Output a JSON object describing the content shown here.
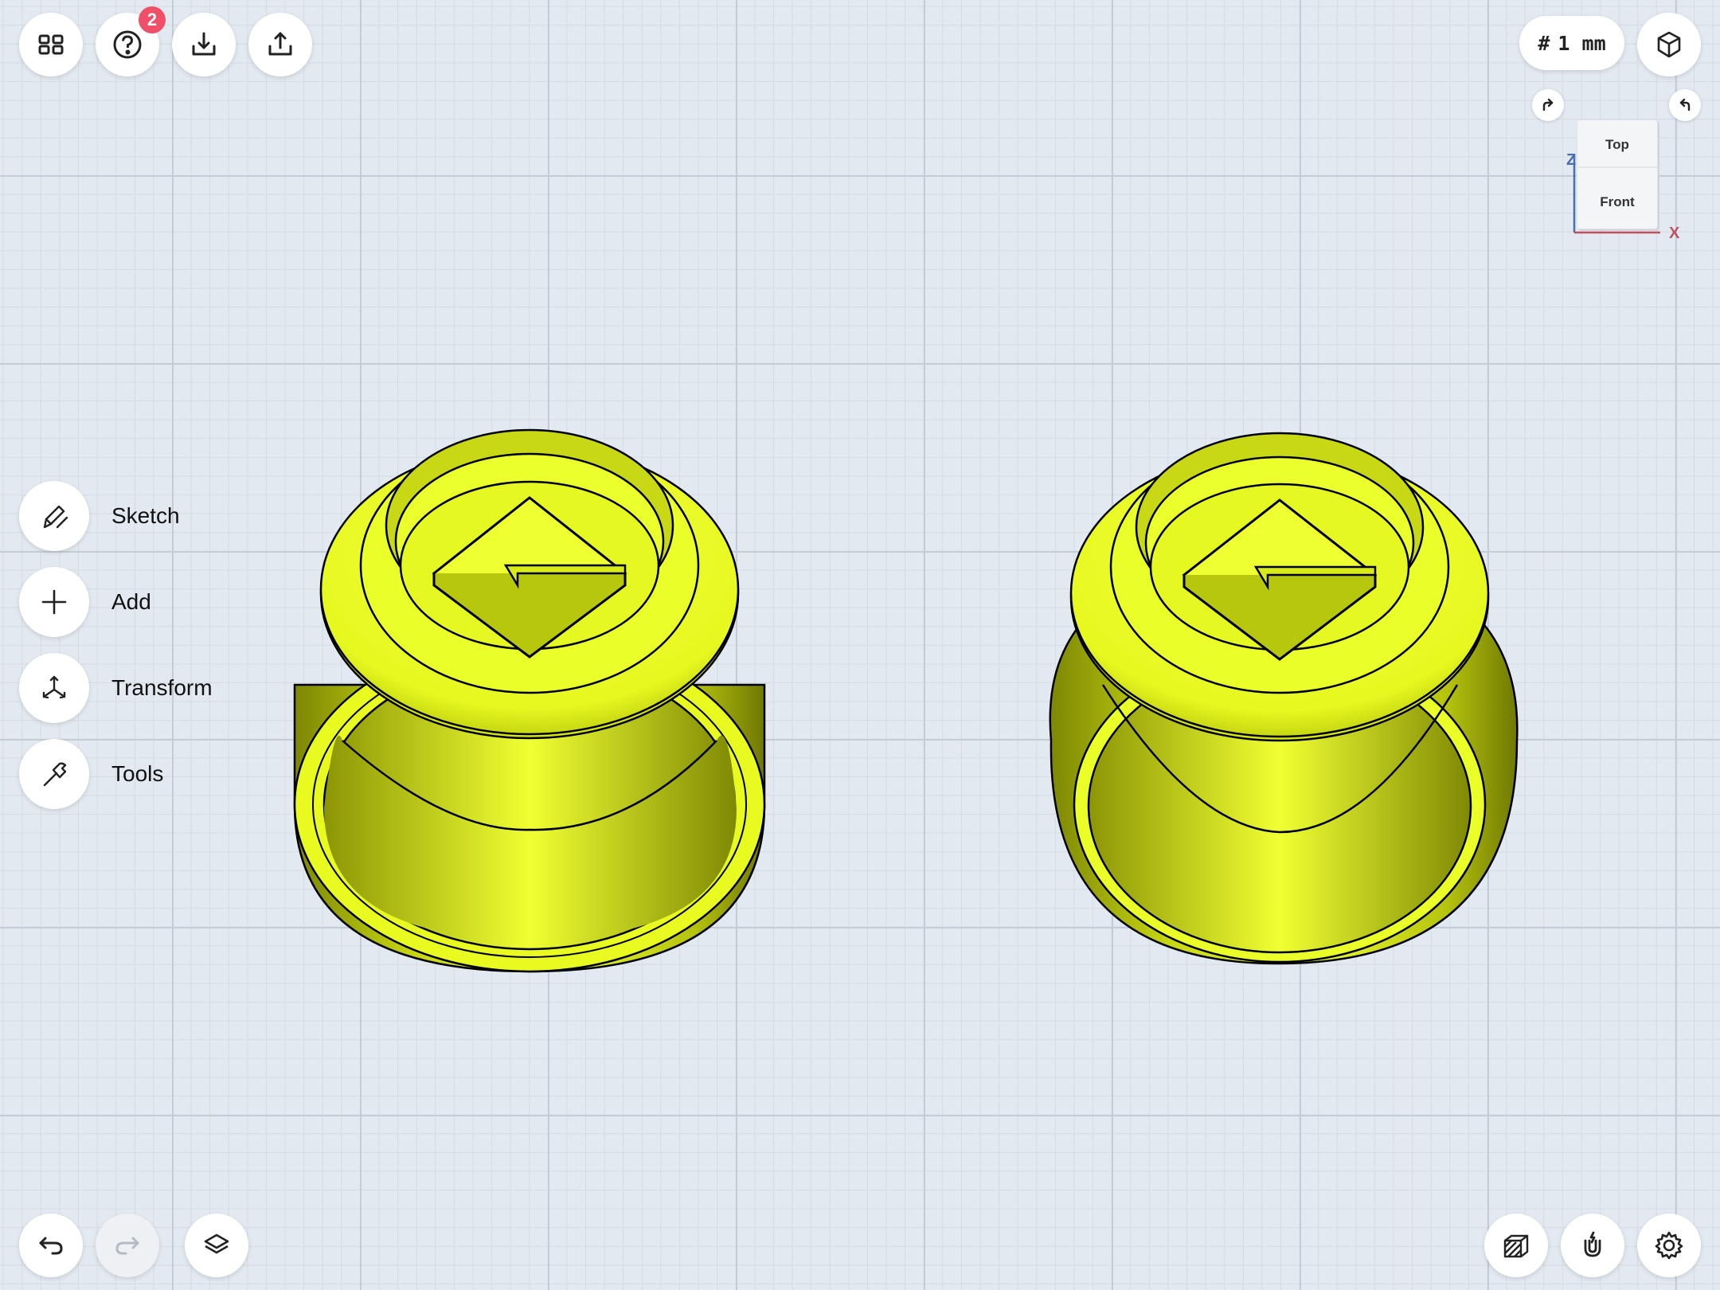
{
  "toolbar_top": {
    "help_badge": "2",
    "grid_prefix": "#",
    "grid_size": "1 mm"
  },
  "menu": {
    "items": [
      {
        "label": "Sketch"
      },
      {
        "label": "Add"
      },
      {
        "label": "Transform"
      },
      {
        "label": "Tools"
      }
    ]
  },
  "viewcube": {
    "top_label": "Top",
    "front_label": "Front",
    "x_axis": "X",
    "z_axis": "Z",
    "x_color": "#c0505e",
    "z_color": "#4a6fb0"
  },
  "colors": {
    "model_yellow": "#ecff2a",
    "model_shadow": "#8a9405",
    "badge": "#ef4f67"
  },
  "icons": {
    "top_left": [
      "grid-icon",
      "help-icon",
      "import-icon",
      "export-icon"
    ],
    "top_right": [
      "cube-view-icon"
    ],
    "bottom_left": [
      "undo-icon",
      "redo-icon",
      "layers-icon"
    ],
    "bottom_right": [
      "render-mode-icon",
      "snap-magnet-icon",
      "settings-gear-icon"
    ]
  }
}
